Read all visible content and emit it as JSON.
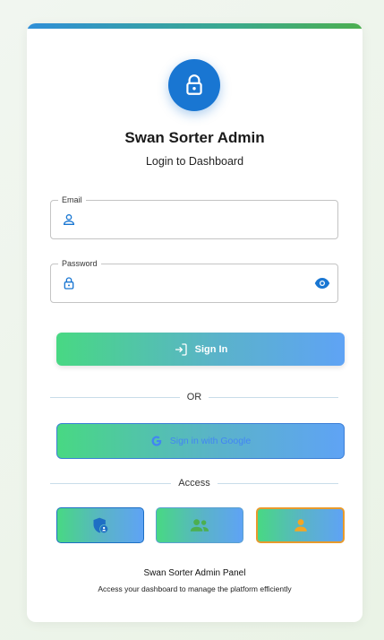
{
  "header": {
    "title": "Swan Sorter Admin",
    "subtitle": "Login to Dashboard"
  },
  "form": {
    "email": {
      "label": "Email",
      "value": "",
      "placeholder": ""
    },
    "password": {
      "label": "Password",
      "value": "",
      "placeholder": ""
    }
  },
  "actions": {
    "sign_in_label": "Sign In",
    "or_label": "OR",
    "google_label": "Sign in with Google",
    "access_label": "Access"
  },
  "roles": [
    {
      "name": "admin",
      "icon": "admin-shield-icon",
      "color": "#1e6fc4",
      "selected": false
    },
    {
      "name": "users",
      "icon": "group-icon",
      "color": "#4caf50",
      "selected": false
    },
    {
      "name": "user",
      "icon": "person-icon",
      "color": "#f5a623",
      "selected": true
    }
  ],
  "footer": {
    "title": "Swan Sorter Admin Panel",
    "description": "Access your dashboard to manage the platform efficiently"
  },
  "colors": {
    "primary": "#1976d2",
    "gradient_start": "#48d883",
    "gradient_end": "#5fa3f5",
    "accent_orange": "#f5a623",
    "google_blue": "#4285f4"
  }
}
